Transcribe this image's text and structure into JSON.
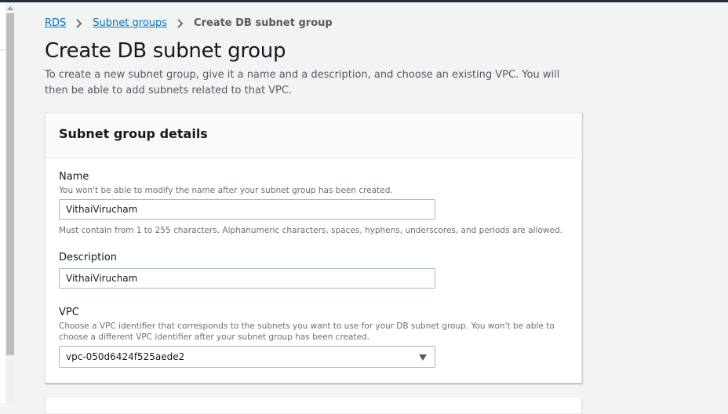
{
  "breadcrumb": {
    "items": [
      {
        "label": "RDS"
      },
      {
        "label": "Subnet groups"
      },
      {
        "label": "Create DB subnet group"
      }
    ]
  },
  "page": {
    "title": "Create DB subnet group",
    "description": "To create a new subnet group, give it a name and a description, and choose an existing VPC. You will then be able to add subnets related to that VPC."
  },
  "details": {
    "title": "Subnet group details",
    "name": {
      "label": "Name",
      "hint": "You won't be able to modify the name after your subnet group has been created.",
      "value": "VithaiVirucham",
      "constraint": "Must contain from 1 to 255 characters. Alphanumeric characters, spaces, hyphens, underscores, and periods are allowed."
    },
    "description": {
      "label": "Description",
      "value": "VithaiVirucham"
    },
    "vpc": {
      "label": "VPC",
      "hint": "Choose a VPC identifier that corresponds to the subnets you want to use for your DB subnet group. You won't be able to choose a different VPC identifier after your subnet group has been created.",
      "value": "vpc-050d6424f525aede2"
    }
  },
  "colors": {
    "link": "#0073bb",
    "top_bar": "#232f3e",
    "background": "#f2f3f3",
    "panel_header": "#fafafa"
  }
}
